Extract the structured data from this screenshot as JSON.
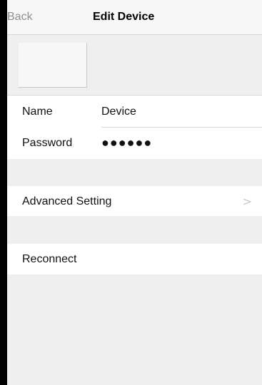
{
  "nav": {
    "back_label": "Back",
    "title": "Edit Device"
  },
  "device": {
    "name_label": "Name",
    "name_value": "Device",
    "password_label": "Password",
    "password_value": "●●●●●●"
  },
  "menu": {
    "advanced_label": "Advanced Setting",
    "chevron": ">",
    "reconnect_label": "Reconnect"
  }
}
